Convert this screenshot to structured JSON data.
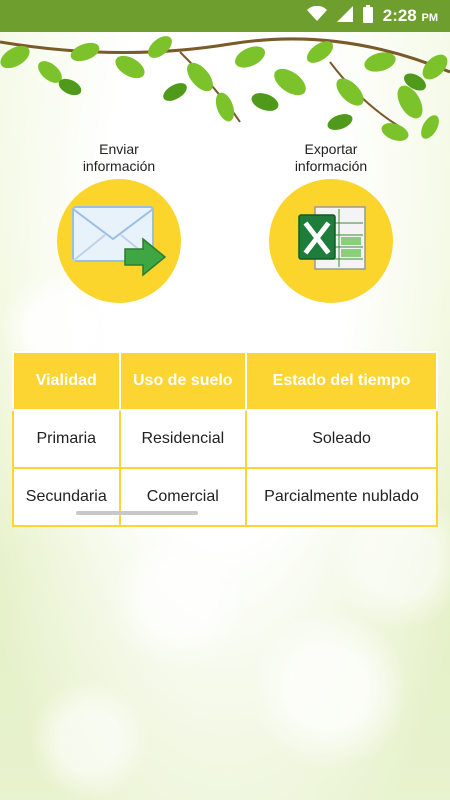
{
  "status_bar": {
    "time": "2:28",
    "ampm": "PM"
  },
  "actions": {
    "send_line1": "Enviar",
    "send_line2": "información",
    "export_line1": "Exportar",
    "export_line2": "información"
  },
  "table": {
    "headers": [
      "Vialidad",
      "Uso de suelo",
      "Estado del tiempo"
    ],
    "rows": [
      [
        "Primaria",
        "Residencial",
        "Soleado"
      ],
      [
        "Secundaria",
        "Comercial",
        "Parcialmente nublado"
      ]
    ]
  },
  "colors": {
    "status_bar": "#6e9e2e",
    "accent": "#fcd533"
  },
  "icons": [
    "wifi-icon",
    "signal-icon",
    "battery-icon",
    "envelope-icon",
    "excel-icon"
  ]
}
